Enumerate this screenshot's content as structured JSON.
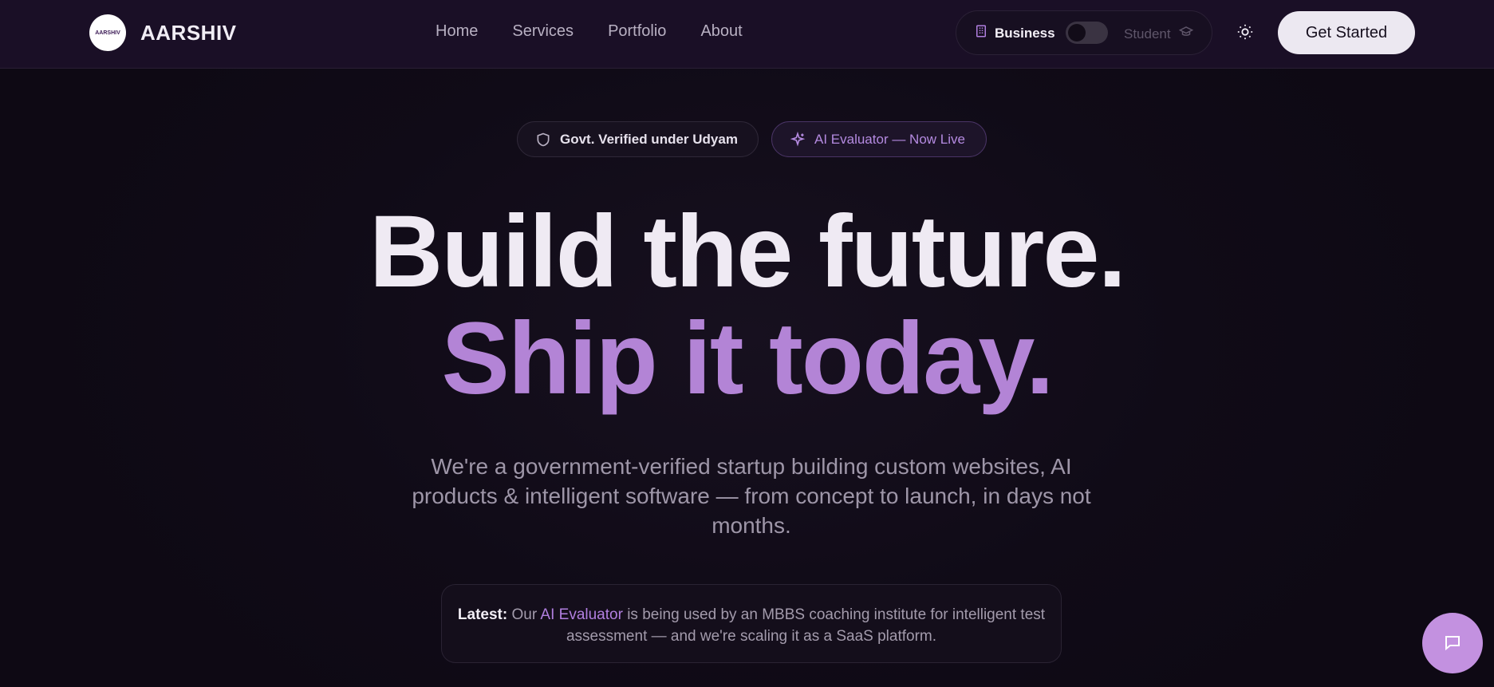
{
  "nav": {
    "logo_text": "AARSHIV",
    "brand": "AARSHIV",
    "links": [
      "Home",
      "Services",
      "Portfolio",
      "About"
    ],
    "mode": {
      "business": "Business",
      "student": "Student",
      "selected": "Business"
    },
    "theme_icon": "sun-icon",
    "cta": "Get Started"
  },
  "badges": {
    "gov": "Govt. Verified under Udyam",
    "ai": "AI Evaluator — Now Live"
  },
  "hero": {
    "line1": "Build the future.",
    "line2": "Ship it today.",
    "subtitle": "We're a government-verified startup building custom websites, AI products & intelligent software — from concept to launch, in days not months."
  },
  "latest": {
    "label": "Latest:",
    "pre": "Our",
    "highlight": "AI Evaluator",
    "post": "is being used by an MBBS coaching institute for intelligent test assessment — and we're scaling it as a SaaS platform."
  },
  "colors": {
    "accent": "#b384d6",
    "bg": "#0f0a16",
    "nav_bg": "#1a0f26"
  },
  "chat_icon": "chat-bubble-icon"
}
